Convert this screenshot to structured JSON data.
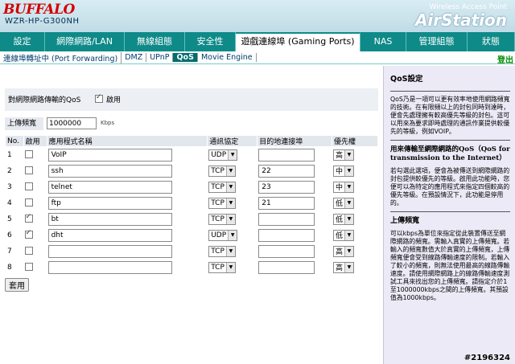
{
  "brand": {
    "logo": "BUFFALO",
    "model": "WZR-HP-G300NH",
    "tagline": "Wireless Access Point",
    "product": "AirStation"
  },
  "tabs": [
    {
      "label": "設定",
      "width": 56
    },
    {
      "label": "網際網路/LAN",
      "width": 99
    },
    {
      "label": "無線組態",
      "width": 75
    },
    {
      "label": "安全性",
      "width": 63
    },
    {
      "label": "遊戲連線埠 (Gaming Ports)",
      "width": 155,
      "active": true
    },
    {
      "label": "NAS",
      "width": 57
    },
    {
      "label": "管理組態",
      "width": 76
    },
    {
      "label": "狀態",
      "width": 59
    }
  ],
  "subtabs": [
    "連線埠轉址中 (Port Forwarding)",
    "DMZ",
    "UPnP",
    "QoS",
    "Movie Engine"
  ],
  "logout": "登出",
  "settings": {
    "label": "對網際網路傳輸的QoS",
    "enable_label": "啟用"
  },
  "upload": {
    "label": "上傳頻寬",
    "value": "1000000",
    "unit": "Kbps"
  },
  "table": {
    "headers": [
      "No.",
      "啟用",
      "應用程式名稱",
      "通訊協定",
      "目的地連接埠",
      "優先權"
    ],
    "rows": [
      {
        "no": "1",
        "enabled": false,
        "name": "VoIP",
        "proto": "UDP",
        "port": "",
        "prio": "高"
      },
      {
        "no": "2",
        "enabled": false,
        "name": "ssh",
        "proto": "TCP",
        "port": "22",
        "prio": "中"
      },
      {
        "no": "3",
        "enabled": false,
        "name": "telnet",
        "proto": "TCP",
        "port": "23",
        "prio": "中"
      },
      {
        "no": "4",
        "enabled": false,
        "name": "ftp",
        "proto": "TCP",
        "port": "21",
        "prio": "低"
      },
      {
        "no": "5",
        "enabled": true,
        "name": "bt",
        "proto": "TCP",
        "port": "",
        "prio": "低"
      },
      {
        "no": "6",
        "enabled": true,
        "name": "dht",
        "proto": "UDP",
        "port": "",
        "prio": "低"
      },
      {
        "no": "7",
        "enabled": false,
        "name": "",
        "proto": "TCP",
        "port": "",
        "prio": "高"
      },
      {
        "no": "8",
        "enabled": false,
        "name": "",
        "proto": "TCP",
        "port": "",
        "prio": "高"
      }
    ]
  },
  "apply_label": "套用",
  "help": {
    "title": "QoS設定",
    "intro": "QoS乃是一項可以更有效率地使用網路頻寬的技術。在有限頻以上的封包同時到達時，便會先處理擁有較高優先等級的封包。這可以用來為要求即時處理的通訊作業提供較優先的等級，例如VOIP。",
    "h2": "用來傳輸至網際網路的QoS（QoS for transmission to the Internet）",
    "p2": "若勾選此選項，便會為被傳送到網際網路的封包提供較優先的等級。啟用此功能時，您便可以為特定的應用程式來指定四個較高的優先等級。在預設情況下，此功能是停用的。",
    "h3": "上傳頻寬",
    "p3": "可以kbps為單位來指定從此裝置傳送至網際網路的頻寬。需輸入真實的上傳頻寬。若輸入的頻寬數值大於真實的上傳頻寬，上傳頻寬便會受到線路傳輸速度的限制。若輸入了較小的頻寬，則無法使用最高的線路傳輸速度。請使用網際網路上的線路傳輸速度測試工具來找出您的上傳頻寬。請指定介於1至1000000kbps之間的上傳頻寬。其預設值為1000kbps。"
  },
  "watermark": "#2196324"
}
